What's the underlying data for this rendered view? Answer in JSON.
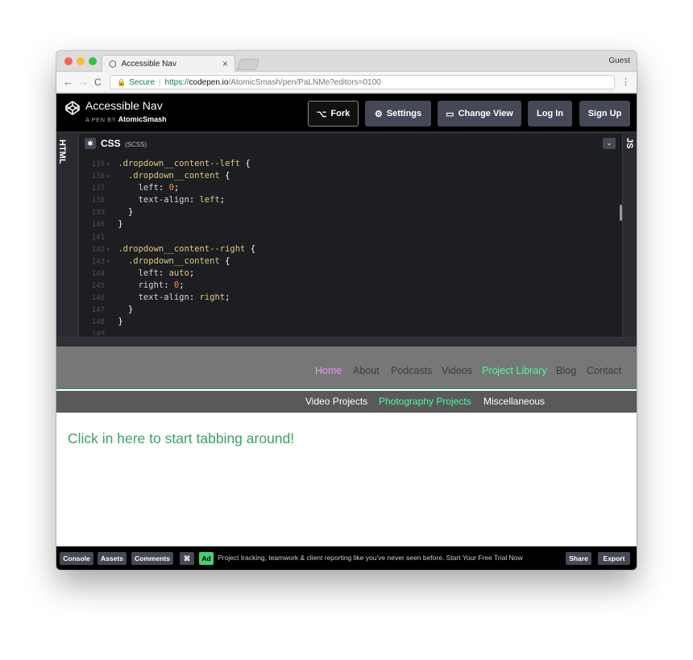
{
  "browser": {
    "tab_title": "Accessible Nav",
    "tab_close": "×",
    "profile": "Guest",
    "secure_label": "Secure",
    "url_scheme": "https://",
    "url_host": "codepen.io",
    "url_path": "/AtomicSmash/pen/PaLNMe?editors=0100",
    "menu_icon": "⋮",
    "back_icon": "←",
    "forward_icon": "→",
    "reload_icon": "C"
  },
  "header": {
    "title": "Accessible Nav",
    "byline_prefix": "A PEN BY",
    "author": "AtomicSmash",
    "buttons": {
      "fork": "Fork",
      "settings": "Settings",
      "change_view": "Change View",
      "login": "Log In",
      "signup": "Sign Up"
    }
  },
  "editor": {
    "html_label": "HTML",
    "js_label": "JS",
    "css_title": "CSS",
    "css_sub": "(SCSS)",
    "lines": [
      {
        "n": "135",
        "fold": "▾",
        "html": "<span class=\"sel\">.dropdown__content--left</span> <span class=\"src\">{</span>"
      },
      {
        "n": "136",
        "fold": "▾",
        "html": "  <span class=\"sel\">.dropdown__content</span> <span class=\"src\">{</span>"
      },
      {
        "n": "137",
        "fold": "",
        "html": "    <span class=\"prop\">left</span><span class=\"src\">:</span> <span class=\"num\">0</span><span class=\"src\">;</span>"
      },
      {
        "n": "138",
        "fold": "",
        "html": "    <span class=\"prop\">text-align</span><span class=\"src\">:</span> <span class=\"kw\">left</span><span class=\"src\">;</span>"
      },
      {
        "n": "139",
        "fold": "",
        "html": "  <span class=\"src\">}</span>"
      },
      {
        "n": "140",
        "fold": "",
        "html": "<span class=\"src\">}</span>"
      },
      {
        "n": "141",
        "fold": "",
        "html": ""
      },
      {
        "n": "142",
        "fold": "▾",
        "html": "<span class=\"sel\">.dropdown__content--right</span> <span class=\"src\">{</span>"
      },
      {
        "n": "143",
        "fold": "▾",
        "html": "  <span class=\"sel\">.dropdown__content</span> <span class=\"src\">{</span>"
      },
      {
        "n": "144",
        "fold": "",
        "html": "    <span class=\"prop\">left</span><span class=\"src\">:</span> <span class=\"kw\">auto</span><span class=\"src\">;</span>"
      },
      {
        "n": "145",
        "fold": "",
        "html": "    <span class=\"prop\">right</span><span class=\"src\">:</span> <span class=\"num\">0</span><span class=\"src\">;</span>"
      },
      {
        "n": "146",
        "fold": "",
        "html": "    <span class=\"prop\">text-align</span><span class=\"src\">:</span> <span class=\"kw\">right</span><span class=\"src\">;</span>"
      },
      {
        "n": "147",
        "fold": "",
        "html": "  <span class=\"src\">}</span>"
      },
      {
        "n": "148",
        "fold": "",
        "html": "<span class=\"src\">}</span>"
      },
      {
        "n": "149",
        "fold": "",
        "html": ""
      }
    ]
  },
  "preview": {
    "primary_nav": [
      "Home",
      "About",
      "Podcasts",
      "Videos",
      "Project Library",
      "Blog",
      "Contact"
    ],
    "secondary_nav": [
      "Video Projects",
      "Photography Projects",
      "Miscellaneous"
    ],
    "hint": "Click in here to start tabbing around!"
  },
  "footer": {
    "console": "Console",
    "assets": "Assets",
    "comments": "Comments",
    "shortcut": "⌘",
    "ad_badge": "Ad",
    "ad_text": "Project tracking, teamwork & client reporting like you've never seen before. Start Your Free Trial Now",
    "share": "Share",
    "export": "Export"
  }
}
